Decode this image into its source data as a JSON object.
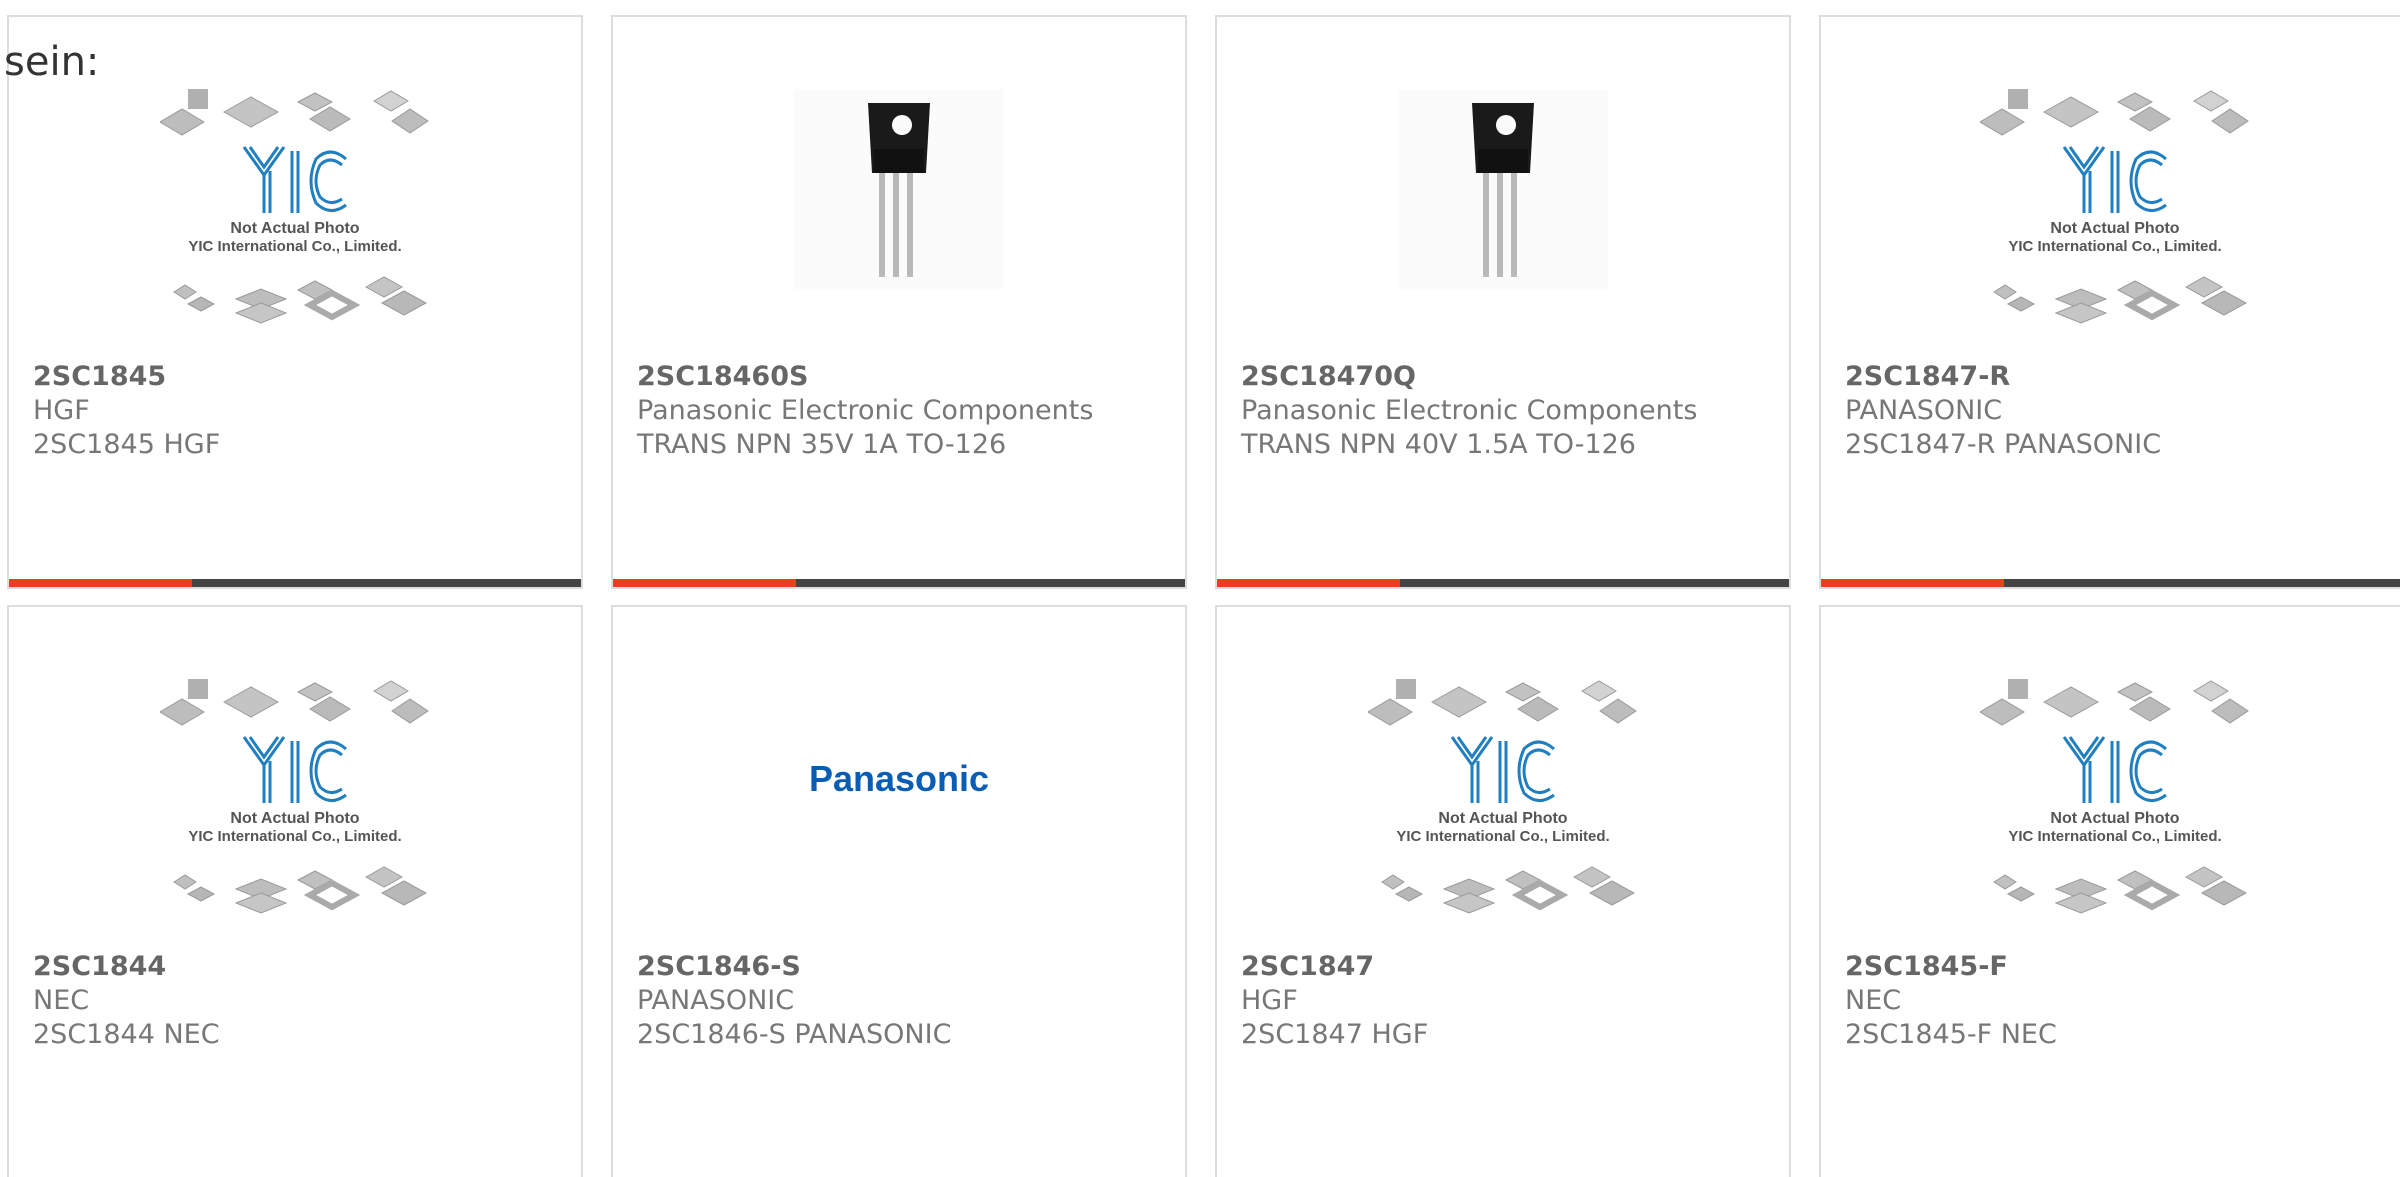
{
  "intro_text": "sein:",
  "placeholder_caption": {
    "line1": "Not Actual Photo",
    "line2": "YIC International Co., Limited."
  },
  "brand_logo_text": "Panasonic",
  "colors": {
    "accent": "#e8401c",
    "bar": "#444444",
    "yic_blue": "#1f7fc0",
    "panasonic_blue": "#0a5db5"
  },
  "products": [
    {
      "part_number": "2SC1845",
      "manufacturer": "HGF",
      "description": "2SC1845 HGF",
      "image": "yic-placeholder"
    },
    {
      "part_number": "2SC18460S",
      "manufacturer": "Panasonic Electronic Components",
      "description": "TRANS NPN 35V 1A TO-126",
      "image": "to126-transistor"
    },
    {
      "part_number": "2SC18470Q",
      "manufacturer": "Panasonic Electronic Components",
      "description": "TRANS NPN 40V 1.5A TO-126",
      "image": "to126-transistor"
    },
    {
      "part_number": "2SC1847-R",
      "manufacturer": "PANASONIC",
      "description": "2SC1847-R PANASONIC",
      "image": "yic-placeholder"
    },
    {
      "part_number": "2SC1844",
      "manufacturer": "NEC",
      "description": "2SC1844 NEC",
      "image": "yic-placeholder"
    },
    {
      "part_number": "2SC1846-S",
      "manufacturer": "PANASONIC",
      "description": "2SC1846-S PANASONIC",
      "image": "panasonic-logo"
    },
    {
      "part_number": "2SC1847",
      "manufacturer": "HGF",
      "description": "2SC1847 HGF",
      "image": "yic-placeholder"
    },
    {
      "part_number": "2SC1845-F",
      "manufacturer": "NEC",
      "description": "2SC1845-F NEC",
      "image": "yic-placeholder"
    }
  ]
}
